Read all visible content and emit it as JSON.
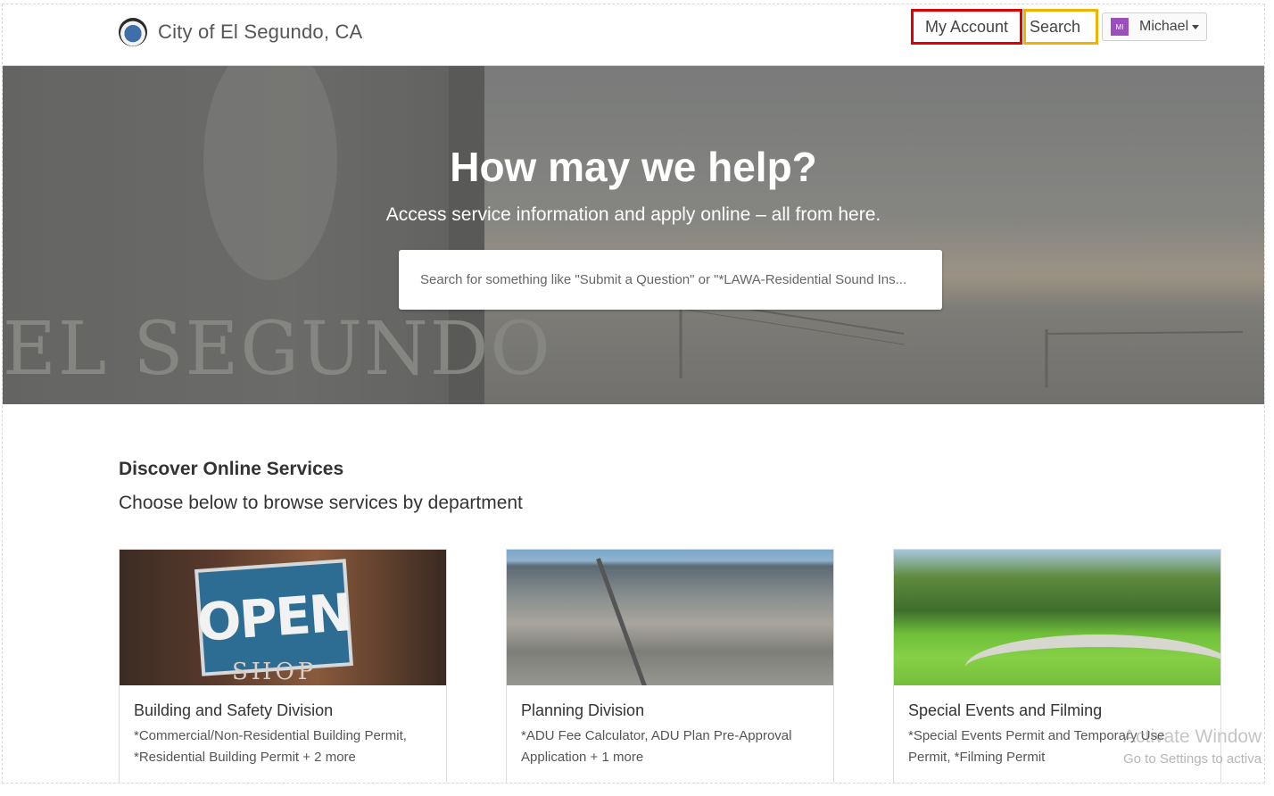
{
  "header": {
    "brand": "City of El Segundo, CA",
    "my_account": "My Account",
    "search": "Search",
    "user": {
      "initials": "MI",
      "name": "Michael"
    }
  },
  "hero": {
    "title": "How may we help?",
    "subtitle": "Access service information and apply online – all from here.",
    "search_placeholder": "Search for something like \"Submit a Question\" or \"*LAWA-Residential Sound Ins...",
    "sign_text": "EL SEGUNDO"
  },
  "discover": {
    "title": "Discover Online Services",
    "subtitle": "Choose below to browse services by department"
  },
  "cards": [
    {
      "title": "Building and Safety Division",
      "line1": "*Commercial/Non-Residential Building Permit,",
      "line2": "*Residential Building Permit + 2 more",
      "image_text_1": "OPEN",
      "image_text_2": "SHOP"
    },
    {
      "title": "Planning Division",
      "line1": "*ADU Fee Calculator, ADU Plan Pre-Approval",
      "line2": "Application + 1 more"
    },
    {
      "title": "Special Events and Filming",
      "line1": "*Special Events Permit and Temporary Use",
      "line2": "Permit, *Filming Permit"
    }
  ],
  "watermark": {
    "line1": "Activate Window",
    "line2": "Go to Settings to activa"
  },
  "colors": {
    "account_highlight": "#e00000",
    "search_highlight": "#f0b400",
    "avatar": "#9b4fbf"
  }
}
